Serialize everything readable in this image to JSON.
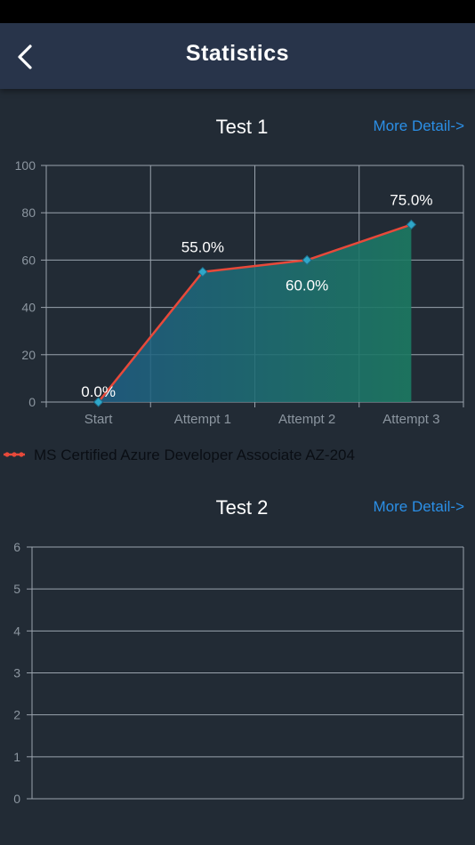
{
  "header": {
    "title": "Statistics",
    "back_icon": "chevron-left-icon"
  },
  "colors": {
    "accent_link": "#2b8fe6",
    "series_line": "#e8493a",
    "marker": "#2fa7c9",
    "background": "#222b35",
    "nav": "#28344a"
  },
  "test1": {
    "title": "Test 1",
    "more_label": "More Detail->",
    "chart_data": {
      "type": "line",
      "categories": [
        "Start",
        "Attempt 1",
        "Attempt 2",
        "Attempt 3"
      ],
      "series": [
        {
          "name": "MS Certified Azure Developer Associate AZ-204",
          "values": [
            0,
            55,
            60,
            75
          ]
        }
      ],
      "value_labels": [
        "0.0%",
        "55.0%",
        "60.0%",
        "75.0%"
      ],
      "yticks": [
        "0",
        "20",
        "40",
        "60",
        "80",
        "100"
      ],
      "ylim": [
        0,
        100
      ],
      "grid": true,
      "legend": "bottom-left"
    }
  },
  "test2": {
    "title": "Test 2",
    "more_label": "More Detail->",
    "chart_data": {
      "type": "line",
      "categories": [],
      "series": [],
      "yticks": [
        "0",
        "1",
        "2",
        "3",
        "4",
        "5",
        "6"
      ],
      "ylim": [
        0,
        6
      ],
      "grid": true
    }
  }
}
